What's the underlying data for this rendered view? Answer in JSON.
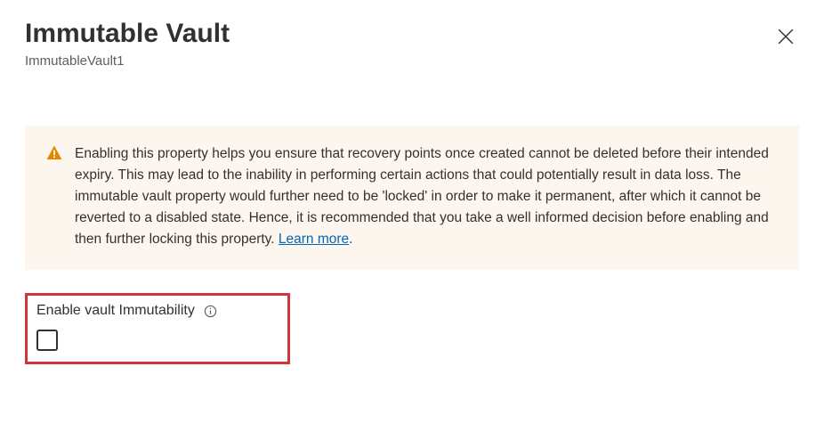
{
  "header": {
    "title": "Immutable Vault",
    "subtitle": "ImmutableVault1"
  },
  "warning": {
    "text": "Enabling this property helps you ensure that recovery points once created cannot be deleted before their intended expiry. This may lead to the inability in performing certain actions that could potentially result in data loss. The immutable vault property would further need to be 'locked' in order to make it permanent, after which it cannot be reverted to a disabled state. Hence, it is recommended that you take a well informed decision before enabling and then further locking this property. ",
    "learn_more_label": "Learn more"
  },
  "form": {
    "enable_label": "Enable vault Immutability",
    "enable_checked": false
  }
}
